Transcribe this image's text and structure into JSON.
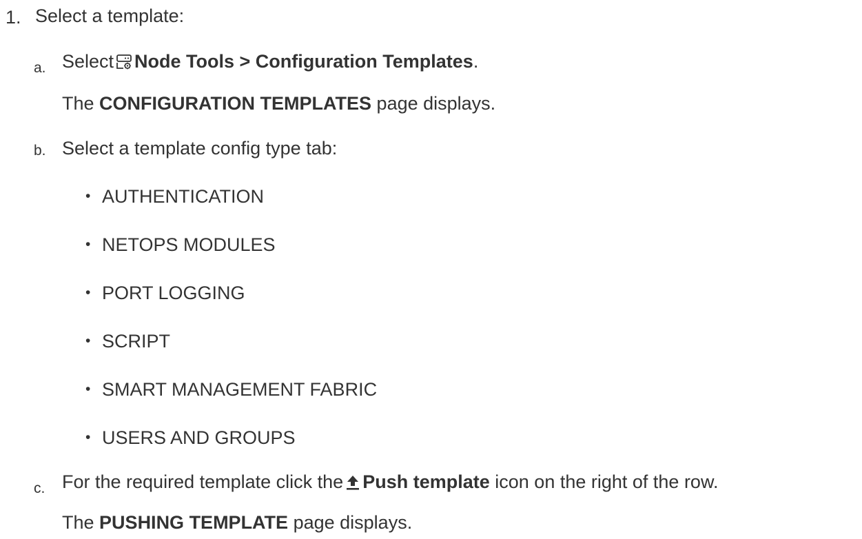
{
  "step1": {
    "marker": "1.",
    "text": "Select a template:"
  },
  "step_a": {
    "marker": "a.",
    "prefix": "Select",
    "icon": "node-tools-icon",
    "path": "Node Tools > Configuration Templates",
    "suffix": ".",
    "result_prefix": "The",
    "result_strong": "CONFIGURATION TEMPLATES",
    "result_suffix": "page displays."
  },
  "step_b": {
    "marker": "b.",
    "text": "Select a template config type tab:",
    "tabs": [
      "AUTHENTICATION",
      "NETOPS MODULES",
      "PORT LOGGING",
      "SCRIPT",
      "SMART MANAGEMENT FABRIC",
      "USERS AND GROUPS"
    ]
  },
  "step_c": {
    "marker": "c.",
    "prefix": "For the required template click the",
    "icon": "push-template-icon",
    "strong": "Push template",
    "suffix": "icon on the right of the row.",
    "result_prefix": "The",
    "result_strong": "PUSHING TEMPLATE",
    "result_suffix": "page displays."
  }
}
